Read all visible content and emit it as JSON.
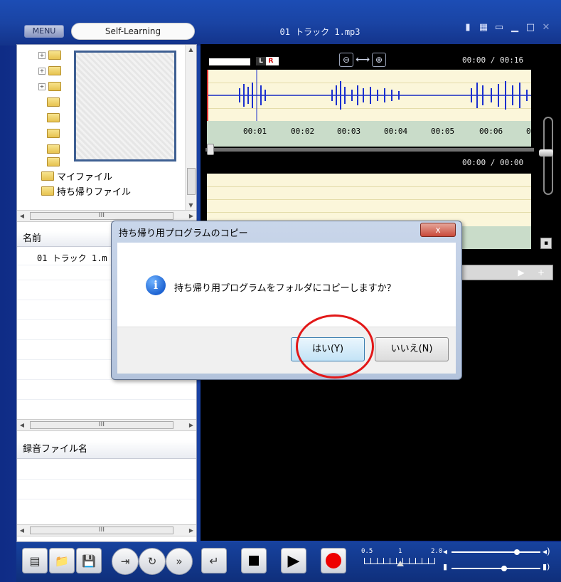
{
  "titlebar": {
    "menu_label": "MENU",
    "mode_tab": "Self-Learning",
    "file_title": "01 トラック 1.mp3",
    "icons": [
      "dock-icon",
      "grid-icon",
      "restore-icon",
      "minimize-icon",
      "maximize-icon",
      "close-icon"
    ]
  },
  "tree": {
    "items": [
      {
        "label": "マイファイル"
      },
      {
        "label": "持ち帰りファイル"
      }
    ]
  },
  "filelist": {
    "header": "名前",
    "rows": [
      "01 トラック 1.m"
    ]
  },
  "recordings": {
    "header": "録音ファイル名"
  },
  "scroll": {
    "thumb_glyph": "III"
  },
  "waveform": {
    "time_readout": "00:00 / 00:16",
    "channel_left": "L",
    "channel_right": "R",
    "tick_labels": [
      "00:01",
      "00:02",
      "00:03",
      "00:04",
      "00:05",
      "00:06",
      "0"
    ]
  },
  "record": {
    "time_readout": "00:00 / 00:00"
  },
  "speed": {
    "min": "0.5",
    "mid": "1",
    "max": "2.0"
  },
  "dialog": {
    "title": "持ち帰り用プログラムのコピー",
    "message": "持ち帰り用プログラムをフォルダにコピーしますか？",
    "yes_label": "はい(Y)",
    "no_label": "いいえ(N)",
    "close_glyph": "x"
  },
  "colors": {
    "accent_red": "#e21818",
    "waveform": "#1b2fcf",
    "titlebar": "#1a44a4"
  }
}
